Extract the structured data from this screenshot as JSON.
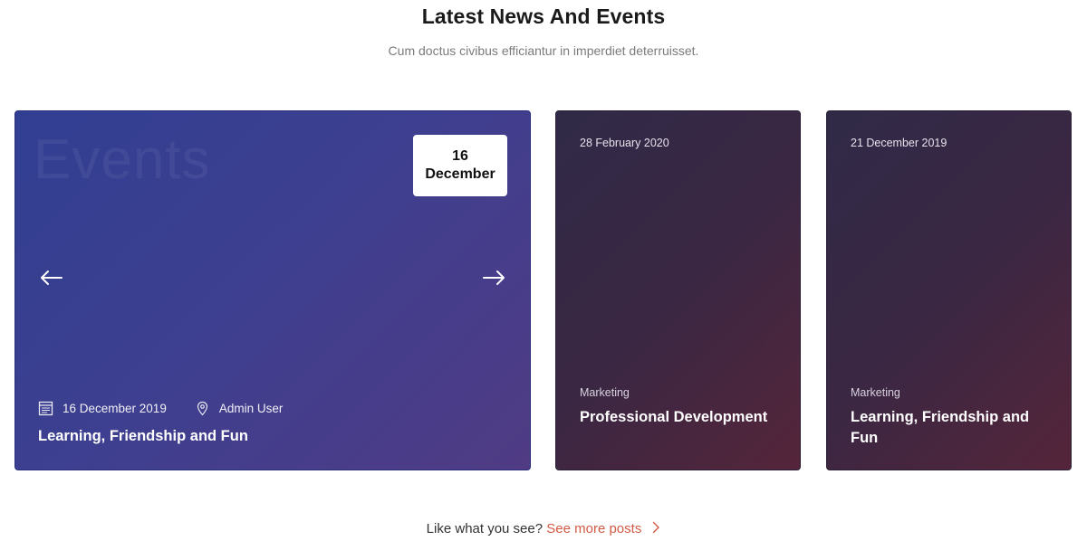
{
  "section": {
    "title": "Latest News And Events",
    "subtitle": "Cum doctus civibus efficiantur in imperdiet deterruisset."
  },
  "featured": {
    "watermark": "Events",
    "badge_day": "16",
    "badge_month": "December",
    "date": "16 December 2019",
    "author": "Admin User",
    "title": "Learning, Friendship and Fun",
    "icons": {
      "date": "calendar-icon",
      "author": "location-pin-icon",
      "prev": "arrow-left-icon",
      "next": "arrow-right-icon"
    }
  },
  "cards": [
    {
      "date": "28 February 2020",
      "category": "Marketing",
      "title": "Professional Development"
    },
    {
      "date": "21 December 2019",
      "category": "Marketing",
      "title": "Learning, Friendship and Fun"
    }
  ],
  "footer": {
    "prompt": "Like what you see?",
    "link": "See more posts",
    "link_icon": "chevron-right-icon"
  },
  "colors": {
    "link": "#d35b45",
    "featured_gradient": [
      "#313f92",
      "#503b84"
    ],
    "card_gradient": [
      "#302a47",
      "#55253a"
    ]
  }
}
